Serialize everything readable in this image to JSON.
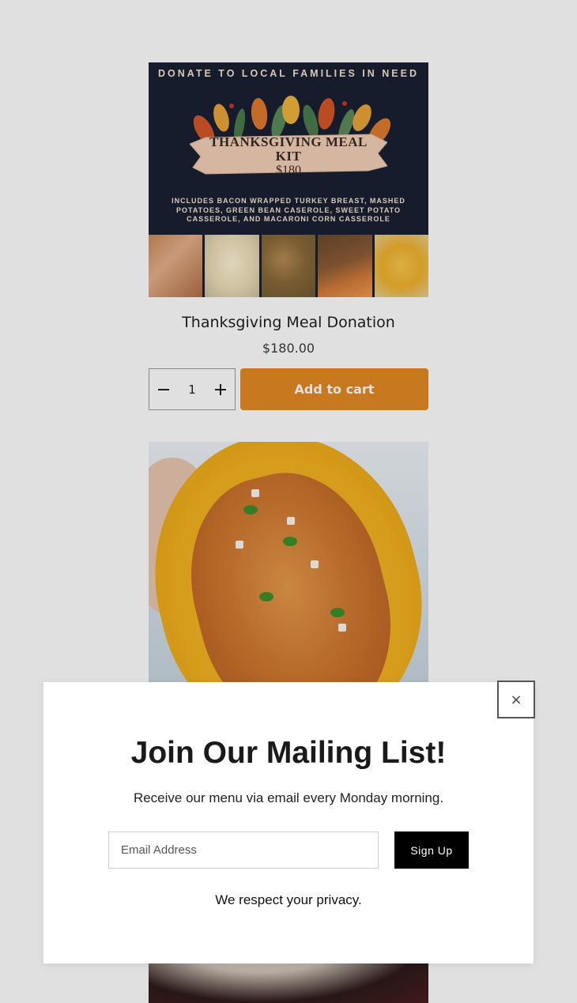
{
  "products": [
    {
      "image": {
        "top_text": "DONATE TO LOCAL FAMILIES IN NEED",
        "banner_line1": "THANKSGIVING MEAL KIT",
        "banner_line2": "$180",
        "description": "INCLUDES BACON WRAPPED TURKEY BREAST, MASHED POTATOES, GREEN BEAN CASEROLE, SWEET POTATO CASSEROLE, AND MACARONI CORN CASSEROLE"
      },
      "title": "Thanksgiving Meal Donation",
      "price": "$180.00",
      "quantity": "1",
      "decrement_icon": "minus-icon",
      "increment_icon": "plus-icon",
      "add_to_cart_label": "Add to cart"
    }
  ],
  "colors": {
    "accent": "#e48a24",
    "poster_bg": "#1a2033",
    "signup_bg": "#000000"
  },
  "modal": {
    "title": "Join Our Mailing List!",
    "subtitle": "Receive our menu via email every Monday morning.",
    "email_placeholder": "Email Address",
    "signup_label": "Sign Up",
    "privacy_text": "We respect your privacy.",
    "close_icon": "close-icon",
    "close_glyph": "×"
  }
}
